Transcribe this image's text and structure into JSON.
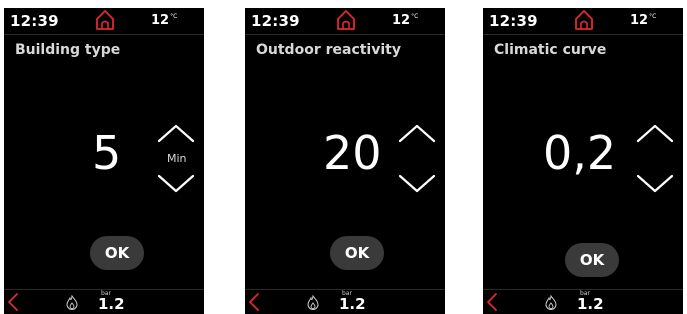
{
  "colors": {
    "background": "#000000",
    "accent_red": "#e0282e",
    "button_bg": "#3a3a3a",
    "text": "#ffffff"
  },
  "screens": [
    {
      "status": {
        "time": "12:39",
        "temperature": "12",
        "temperature_unit": "°C"
      },
      "title": "Building type",
      "value": "5",
      "unit": "Min",
      "ok_label": "OK",
      "bottom": {
        "pressure_unit": "bar",
        "pressure": "1.2"
      }
    },
    {
      "status": {
        "time": "12:39",
        "temperature": "12",
        "temperature_unit": "°C"
      },
      "title": "Outdoor reactivity",
      "value": "20",
      "unit": "",
      "ok_label": "OK",
      "bottom": {
        "pressure_unit": "bar",
        "pressure": "1.2"
      }
    },
    {
      "status": {
        "time": "12:39",
        "temperature": "12",
        "temperature_unit": "°C"
      },
      "title": "Climatic curve",
      "value": "0,2",
      "unit": "",
      "ok_label": "OK",
      "bottom": {
        "pressure_unit": "bar",
        "pressure": "1.2"
      }
    }
  ],
  "icons": {
    "home": "home-icon",
    "increase": "chevron-up-icon",
    "decrease": "chevron-down-icon",
    "back": "back-arrow-icon",
    "flame": "flame-icon"
  }
}
